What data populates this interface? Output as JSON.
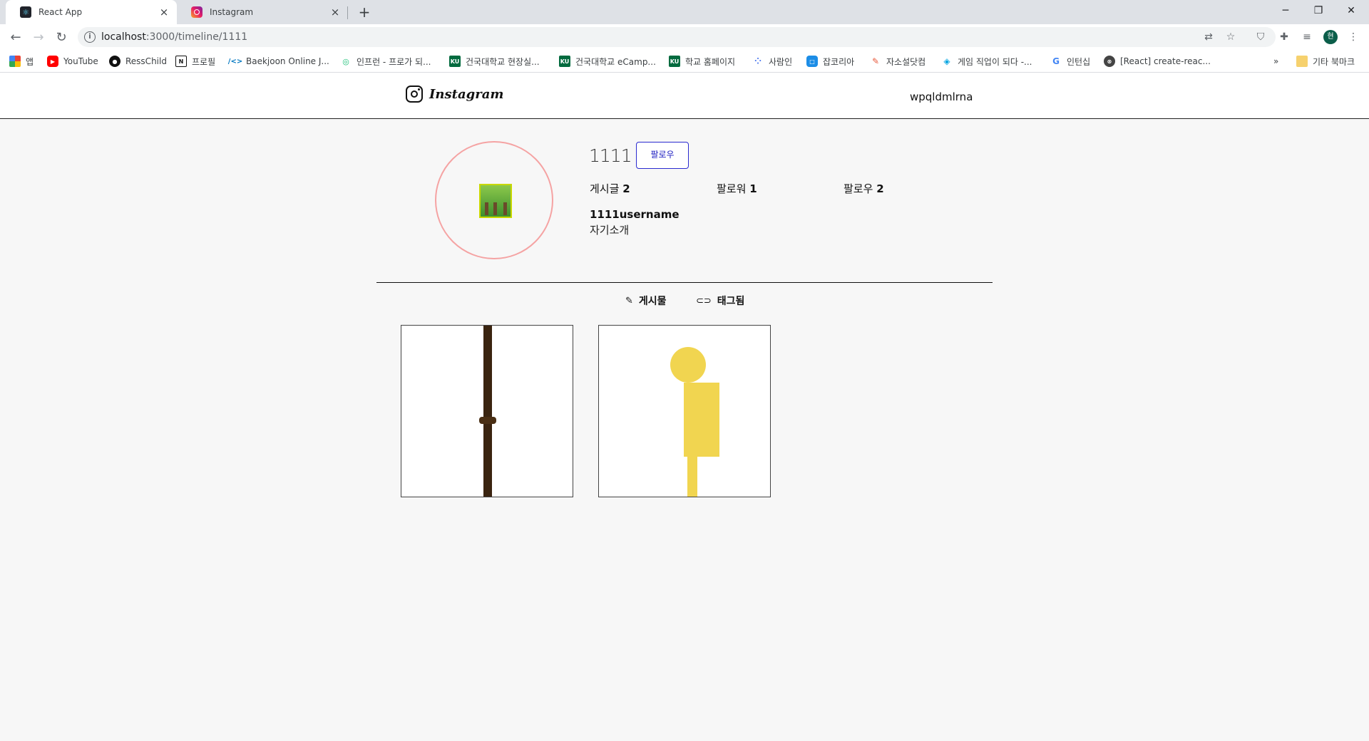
{
  "browser": {
    "tabs": [
      {
        "title": "React App",
        "icon": "react-icon",
        "active": true
      },
      {
        "title": "Instagram",
        "icon": "instagram-icon",
        "active": false
      }
    ],
    "url_host": "localhost",
    "url_path": ":3000/timeline/1111",
    "profile_initial": "현",
    "bookmarks": [
      {
        "label": "앱",
        "icon": "apps-grid-icon",
        "color": "#e94235"
      },
      {
        "label": "YouTube",
        "icon": "youtube-icon",
        "color": "#ff0000"
      },
      {
        "label": "RessChild",
        "icon": "github-icon",
        "color": "#111111"
      },
      {
        "label": "프로필",
        "icon": "notion-icon",
        "color": "#111111"
      },
      {
        "label": "Baekjoon Online J...",
        "icon": "code-icon",
        "color": "#0076c0"
      },
      {
        "label": "인프런 - 프로가 되...",
        "icon": "inflearn-icon",
        "color": "#1dc078"
      },
      {
        "label": "건국대학교 현장실...",
        "icon": "ku-icon",
        "color": "#036b3f"
      },
      {
        "label": "건국대학교 eCamp...",
        "icon": "ku-icon",
        "color": "#036b3f"
      },
      {
        "label": "학교 홈페이지",
        "icon": "ku-icon",
        "color": "#036b3f"
      },
      {
        "label": "사람인",
        "icon": "saramin-icon",
        "color": "#4876ef"
      },
      {
        "label": "잡코리아",
        "icon": "jobkorea-icon",
        "color": "#1c8de6"
      },
      {
        "label": "자소설닷컴",
        "icon": "pen-icon",
        "color": "#e85a3c"
      },
      {
        "label": "게임 직업이 되다 -...",
        "icon": "game-icon",
        "color": "#00a3e0"
      },
      {
        "label": "인턴십",
        "icon": "google-icon",
        "color": "#4285f4"
      },
      {
        "label": "[React] create-reac...",
        "icon": "velog-icon",
        "color": "#444444"
      }
    ],
    "more_bookmarks": "»",
    "other_bookmarks": "기타 북마크"
  },
  "header": {
    "logo_text": "Instagram",
    "username": "wpqldmlrna"
  },
  "profile": {
    "id": "1111",
    "follow_label": "팔로우",
    "stats": [
      {
        "label": "게시글",
        "value": "2"
      },
      {
        "label": "팔로워",
        "value": "1"
      },
      {
        "label": "팔로우",
        "value": "2"
      }
    ],
    "username": "1111username",
    "bio": "자기소개"
  },
  "tabs": {
    "posts_label": "게시물",
    "tagged_label": "태그됨"
  },
  "colors": {
    "avatar_ring": "#f5a3a3",
    "follow_border": "#2a2ad0",
    "post2_figure": "#f1d550",
    "post1_pole": "#3a2410"
  }
}
